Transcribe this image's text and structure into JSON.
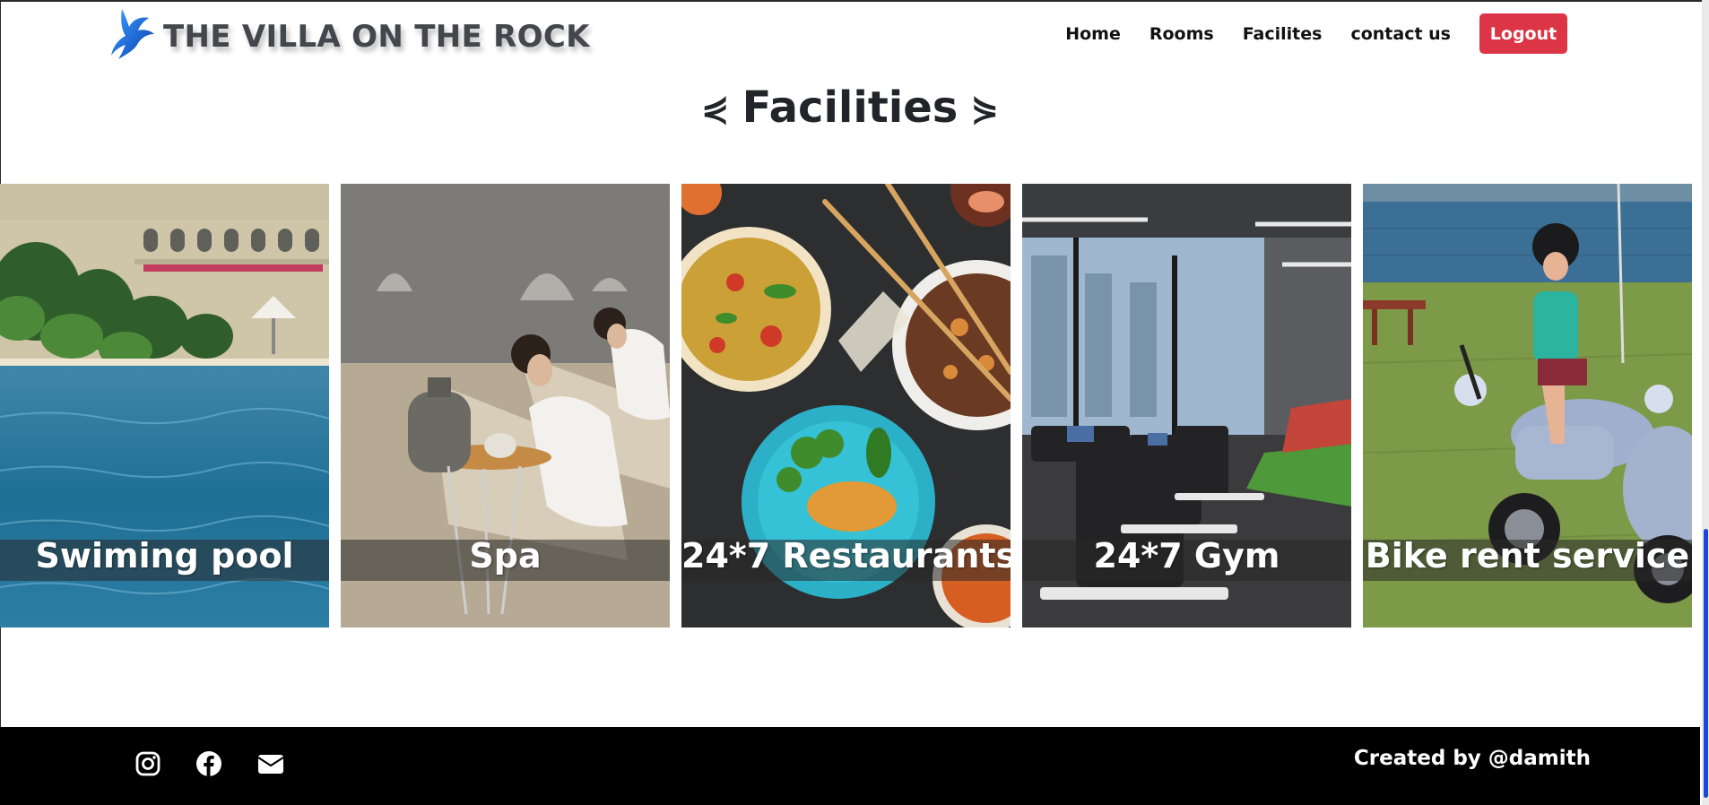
{
  "brand": {
    "title": "THE VILLA ON THE ROCK",
    "logo_icon": "bird-logo-icon",
    "title_color": "#43474c"
  },
  "nav": {
    "links": [
      "Home",
      "Rooms",
      "Facilites",
      "contact us"
    ],
    "logout_label": "Logout",
    "logout_color": "#dc3545"
  },
  "section": {
    "title": "Facilities",
    "left_deco": "⋞",
    "right_deco": "⋟"
  },
  "facilities": [
    {
      "label": "Swiming pool",
      "image": "swimming-pool-photo"
    },
    {
      "label": "Spa",
      "image": "spa-photo"
    },
    {
      "label": "24*7 Restaurants",
      "image": "restaurant-food-photo"
    },
    {
      "label": "24*7 Gym",
      "image": "gym-treadmills-photo"
    },
    {
      "label": "Bike rent service",
      "image": "scooter-rental-photo"
    }
  ],
  "footer": {
    "social_icons": [
      "instagram-icon",
      "facebook-icon",
      "email-icon"
    ],
    "credit": "Created by @damith",
    "background": "#000000"
  }
}
